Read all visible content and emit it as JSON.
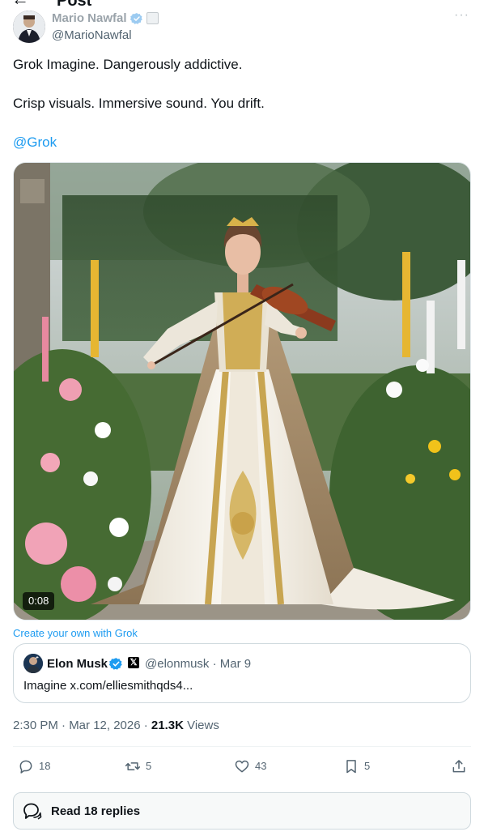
{
  "header": {
    "title": "Post",
    "back_icon": "arrow-left-icon"
  },
  "author": {
    "display_name": "Mario Nawfal",
    "handle": "@MarioNawfal",
    "verified": true,
    "more_icon": "more-icon"
  },
  "tweet": {
    "line1": "Grok Imagine. Dangerously addictive.",
    "line2": "Crisp visuals. Immersive sound. You drift.",
    "mention": "@Grok"
  },
  "media": {
    "duration": "0:08"
  },
  "create_link": "Create your own with Grok",
  "quote": {
    "name": "Elon Musk",
    "handle": "@elonmusk · Mar 9",
    "x_badge": "𝕏",
    "text": "Imagine x.com/elliesmithqds4..."
  },
  "meta": {
    "time": "2:30 PM · Mar 12, 2026 · ",
    "views_count": "21.3K",
    "views_label": " Views"
  },
  "actions": {
    "replies": "18",
    "reposts": "5",
    "likes": "43",
    "bookmarks": "5"
  },
  "read_replies": "Read 18 replies",
  "colors": {
    "accent": "#1d9bf0",
    "text": "#0f1419",
    "muted": "#536471"
  }
}
